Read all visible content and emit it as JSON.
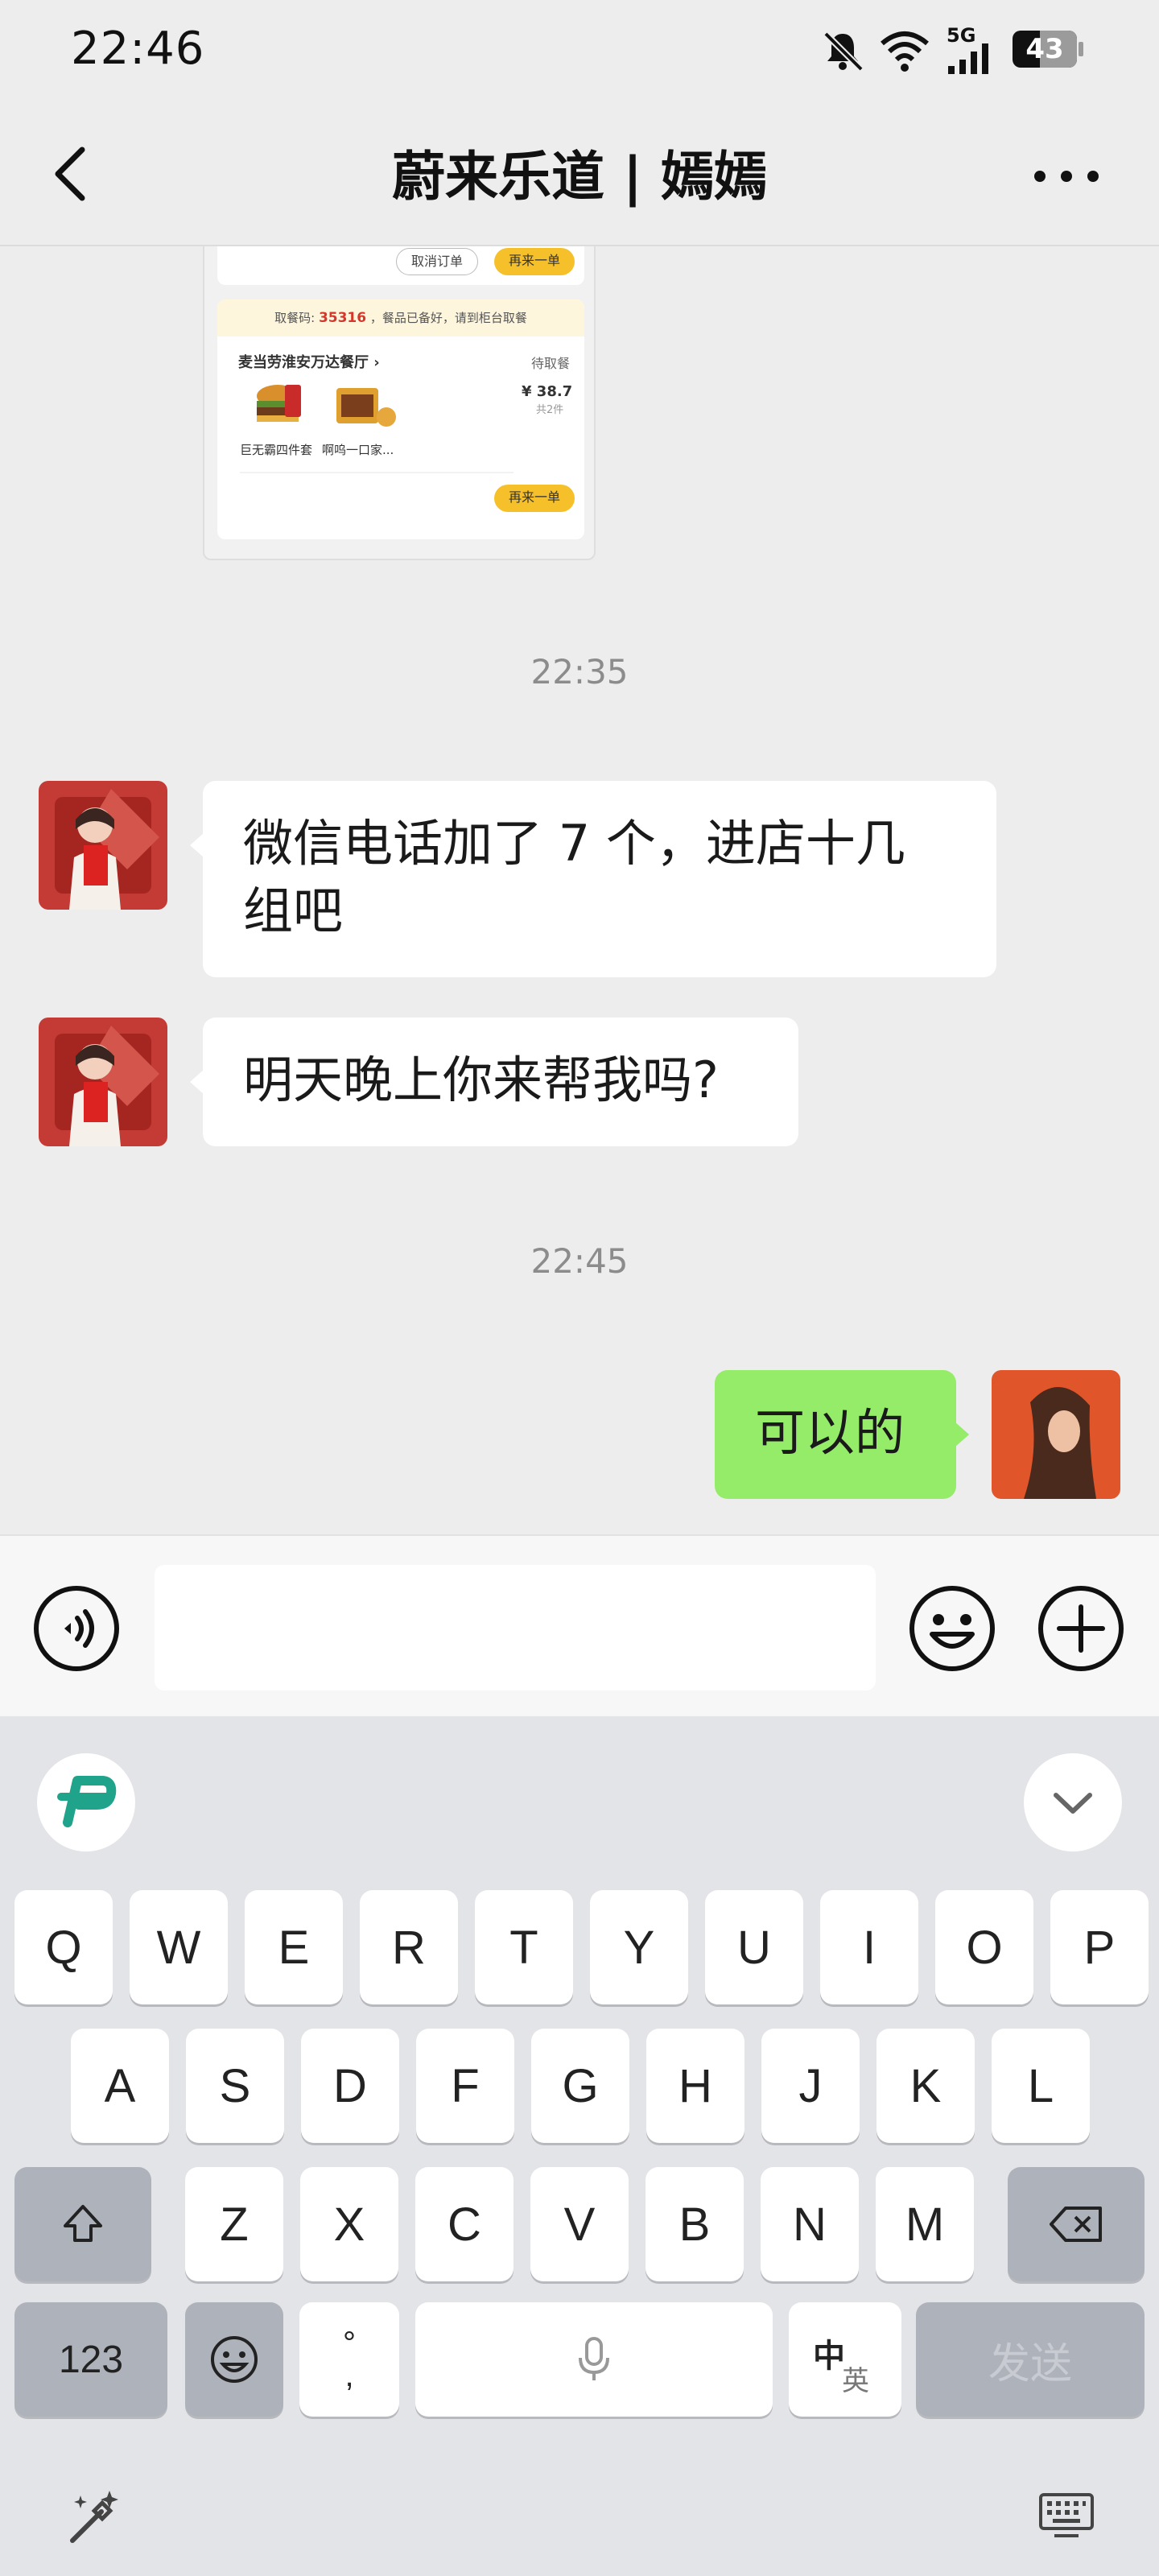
{
  "status_bar": {
    "time": "22:46",
    "network": "5G",
    "battery": "43",
    "icons": [
      "mute-bell-icon",
      "wifi-icon",
      "signal-icon",
      "battery-icon"
    ]
  },
  "nav": {
    "title": "蔚来乐道 | 嫣嫣",
    "back_icon": "chevron-left-icon",
    "more_icon": "more-dots-icon"
  },
  "order_card": {
    "cancel_label": "取消订单",
    "reorder_label": "再来一单",
    "pickup_prefix": "取餐码:",
    "pickup_code": "35316",
    "pickup_suffix": "，餐品已备好，请到柜台取餐",
    "store_name": "麦当劳淮安万达餐厅 ›",
    "status": "待取餐",
    "price": "¥ 38.7",
    "count": "共2件",
    "item1": "巨无霸四件套",
    "item2": "啊呜一口家...",
    "reorder_label2": "再来一单"
  },
  "messages": [
    {
      "type": "time",
      "text": "22:35"
    },
    {
      "type": "text",
      "side": "left",
      "text": "微信电话加了 7 个，进店十几组吧"
    },
    {
      "type": "text",
      "side": "left",
      "text": "明天晚上你来帮我吗?"
    },
    {
      "type": "time",
      "text": "22:45"
    },
    {
      "type": "text",
      "side": "right",
      "text": "可以的"
    }
  ],
  "message_lines": {
    "m1_line1": "微信电话加了 7 个，进店十几",
    "m1_line2": "组吧"
  },
  "input_bar": {
    "voice_icon": "voice-icon",
    "emoji_icon": "emoji-icon",
    "plus_icon": "plus-icon",
    "input_value": ""
  },
  "keyboard": {
    "row1": [
      "Q",
      "W",
      "E",
      "R",
      "T",
      "Y",
      "U",
      "I",
      "O",
      "P"
    ],
    "row2": [
      "A",
      "S",
      "D",
      "F",
      "G",
      "H",
      "J",
      "K",
      "L"
    ],
    "row3": [
      "Z",
      "X",
      "C",
      "V",
      "B",
      "N",
      "M"
    ],
    "num_key": "123",
    "punct_top": "°",
    "punct_bottom": ",",
    "lang_main": "中",
    "lang_sub": "英",
    "send_label": "发送"
  }
}
